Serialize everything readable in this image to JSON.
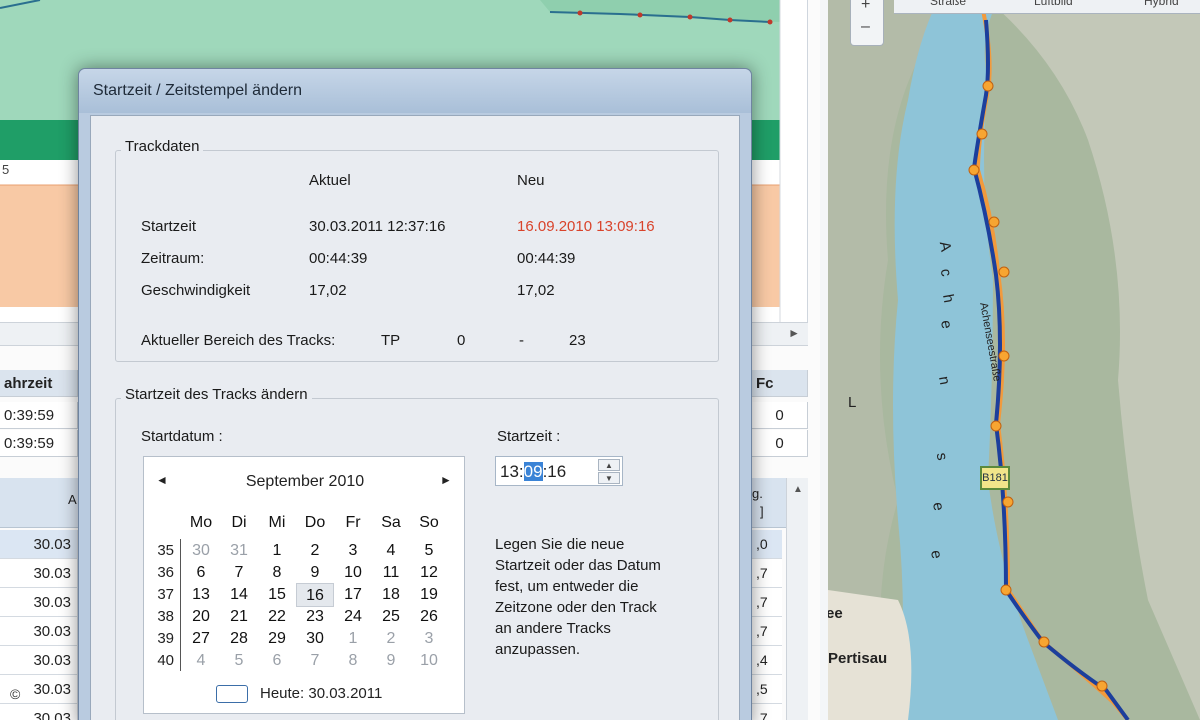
{
  "background": {
    "chart_left_label": "5",
    "table_headers": [
      "ahrzeit",
      "Fc"
    ],
    "table_rows": [
      [
        "0:39:59",
        "0"
      ],
      [
        "0:39:59",
        "0"
      ]
    ],
    "grid_header": [
      "A",
      "g.",
      "]"
    ],
    "grid_dates": [
      "30.03",
      "30.03",
      "30.03",
      "30.03",
      "30.03",
      "30.03",
      "30.03"
    ],
    "grid_right": [
      ",0",
      ",7",
      ",7",
      ",7",
      ",4",
      ",5",
      ",7"
    ],
    "scroll_arrow": "►",
    "copyright": "©"
  },
  "map": {
    "tabs": [
      "Straße",
      "Luftbild",
      "Hybrid"
    ],
    "lake_label": [
      "A",
      "c",
      "h",
      "e",
      "n",
      "s",
      "e",
      "e"
    ],
    "road_name": "Achenseestraße",
    "road_sign": "B181",
    "place_pertisau": "Pertisau",
    "place_ee": "ee",
    "place_l": "L",
    "zoom_in": "+",
    "zoom_out": "–"
  },
  "dialog": {
    "title": "Startzeit / Zeitstempel ändern",
    "trackdaten": {
      "group_title": "Trackdaten",
      "col_current": "Aktuel",
      "col_new": "Neu",
      "rows": [
        {
          "label": "Startzeit",
          "current": "30.03.2011 12:37:16",
          "new": "16.09.2010 13:09:16"
        },
        {
          "label": "Zeitraum:",
          "current": "00:44:39",
          "new": "00:44:39"
        },
        {
          "label": "Geschwindigkeit",
          "current": "17,02",
          "new": "17,02"
        }
      ],
      "range_label": "Aktueller Bereich des Tracks:",
      "range_unit": "TP",
      "range_from": "0",
      "range_sep": "-",
      "range_to": "23"
    },
    "change": {
      "group_title": "Startzeit des Tracks ändern",
      "date_label": "Startdatum :",
      "time_label": "Startzeit :",
      "time_before": "13:",
      "time_selected": "09",
      "time_after": ":16",
      "hint": [
        "Legen Sie die neue",
        "Startzeit oder das Datum",
        "fest, um entweder die",
        "Zeitzone oder den Track",
        "an andere Tracks",
        "anzupassen."
      ]
    },
    "calendar": {
      "month": "September 2010",
      "prev": "◄",
      "next": "►",
      "weekdays": [
        "Mo",
        "Di",
        "Mi",
        "Do",
        "Fr",
        "Sa",
        "So"
      ],
      "weeks": [
        "35",
        "36",
        "37",
        "38",
        "39",
        "40"
      ],
      "days": [
        [
          "30",
          "31",
          "1",
          "2",
          "3",
          "4",
          "5"
        ],
        [
          "6",
          "7",
          "8",
          "9",
          "10",
          "11",
          "12"
        ],
        [
          "13",
          "14",
          "15",
          "16",
          "17",
          "18",
          "19"
        ],
        [
          "20",
          "21",
          "22",
          "23",
          "24",
          "25",
          "26"
        ],
        [
          "27",
          "28",
          "29",
          "30",
          "1",
          "2",
          "3"
        ],
        [
          "4",
          "5",
          "6",
          "7",
          "8",
          "9",
          "10"
        ]
      ],
      "selected_day": "16",
      "today": "Heute: 30.03.2011"
    }
  }
}
